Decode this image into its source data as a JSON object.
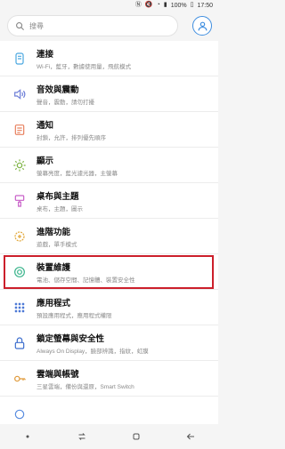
{
  "status": {
    "battery": "100%",
    "time": "17:50"
  },
  "search": {
    "placeholder": "搜尋"
  },
  "items": [
    {
      "title": "連接",
      "subtitle": "Wi-Fi，藍牙，數據使用量，飛航模式"
    },
    {
      "title": "音效與震動",
      "subtitle": "聲音，震動，請勿打擾"
    },
    {
      "title": "通知",
      "subtitle": "封鎖，允許，排列優先順序"
    },
    {
      "title": "顯示",
      "subtitle": "螢幕亮度，藍光濾光器，主螢幕"
    },
    {
      "title": "桌布與主題",
      "subtitle": "桌布，主題，圖示"
    },
    {
      "title": "進階功能",
      "subtitle": "遊戲，單手模式"
    },
    {
      "title": "裝置維護",
      "subtitle": "電池、儲存空間、記憶體、裝置安全性"
    },
    {
      "title": "應用程式",
      "subtitle": "預設應用程式，應用程式權限"
    },
    {
      "title": "鎖定螢幕與安全性",
      "subtitle": "Always On Display，臉部辨識，指紋，虹膜"
    },
    {
      "title": "雲端與帳號",
      "subtitle": "三星雲端，備份與還原，Smart Switch"
    }
  ],
  "colors": {
    "highlight": "#cc1f2b",
    "accent": "#3f8ee0"
  }
}
